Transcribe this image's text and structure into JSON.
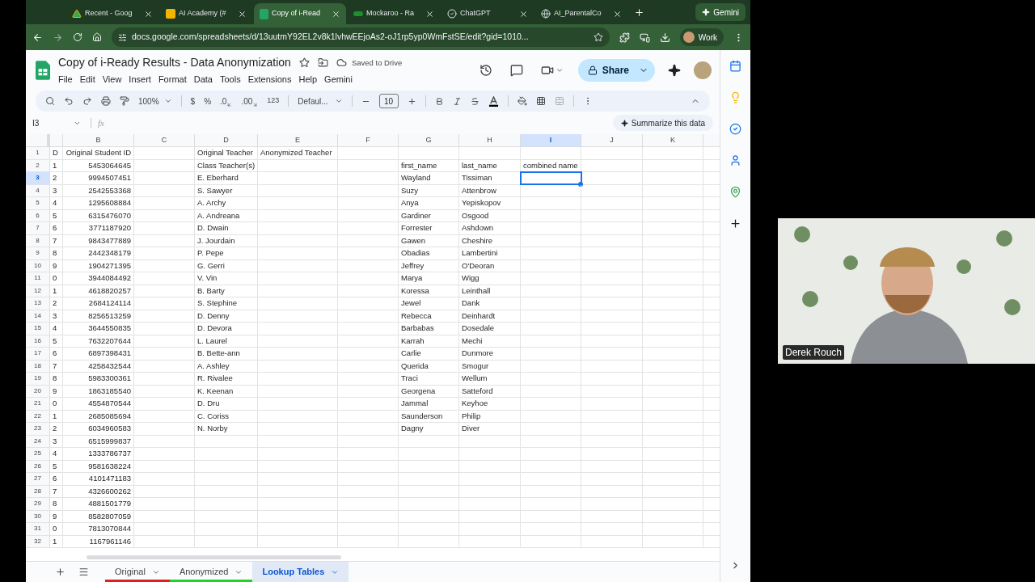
{
  "browser_tabs": [
    {
      "title": "Recent - Goog",
      "selected": false
    },
    {
      "title": "AI Academy (#",
      "selected": false
    },
    {
      "title": "Copy of i-Read",
      "selected": true
    },
    {
      "title": "Mockaroo - Ra",
      "selected": false
    },
    {
      "title": "ChatGPT",
      "selected": false
    },
    {
      "title": "AI_ParentalCo",
      "selected": false
    }
  ],
  "gemini_button": "Gemini",
  "address": "docs.google.com/spreadsheets/d/13uutmY92EL2v8k1lvhwEEjoAs2-oJ1rp5yp0WmFstSE/edit?gid=1010...",
  "profile": "Work",
  "doc": {
    "title": "Copy of i-Ready Results - Data Anonymization",
    "save_status": "Saved to Drive",
    "share": "Share"
  },
  "menu": [
    "File",
    "Edit",
    "View",
    "Insert",
    "Format",
    "Data",
    "Tools",
    "Extensions",
    "Help",
    "Gemini"
  ],
  "toolbar": {
    "zoom": "100%",
    "currency": "$",
    "percent": "%",
    "decrease_decimals": ".0",
    "increase_decimals": ".00",
    "number_format": "123",
    "font": "Defaul...",
    "font_size": "10"
  },
  "name_box": "I3",
  "formula_label": "fx",
  "summarize": "Summarize this data",
  "columns": [
    {
      "selected": false
    },
    {
      "label": "B",
      "selected": false
    },
    {
      "label": "C",
      "selected": false
    },
    {
      "label": "D",
      "selected": false
    },
    {
      "label": "E",
      "selected": false
    },
    {
      "label": "F",
      "selected": false
    },
    {
      "label": "G",
      "selected": false
    },
    {
      "label": "H",
      "selected": false
    },
    {
      "label": "I",
      "selected": true
    },
    {
      "label": "J",
      "selected": false
    },
    {
      "label": "K",
      "selected": false
    }
  ],
  "rows": [
    {
      "number": "1",
      "selected": false,
      "a": "D",
      "b": "Original Student ID",
      "d": "Original Teacher",
      "e": "Anonymized Teacher"
    },
    {
      "number": "2",
      "selected": false,
      "a": "1",
      "b": "5453064645",
      "d": "Class Teacher(s)",
      "g": "first_name",
      "h": "last_name",
      "i": "combined name"
    },
    {
      "number": "3",
      "selected": true,
      "a": "2",
      "b": "9994507451",
      "d": "E. Eberhard",
      "g": "Wayland",
      "h": "Tissiman"
    },
    {
      "number": "4",
      "selected": false,
      "a": "3",
      "b": "2542553368",
      "d": "S. Sawyer",
      "g": "Suzy",
      "h": "Attenbrow"
    },
    {
      "number": "5",
      "selected": false,
      "a": "4",
      "b": "1295608884",
      "d": "A. Archy",
      "g": "Anya",
      "h": "Yepiskopov"
    },
    {
      "number": "6",
      "selected": false,
      "a": "5",
      "b": "6315476070",
      "d": "A. Andreana",
      "g": "Gardiner",
      "h": "Osgood"
    },
    {
      "number": "7",
      "selected": false,
      "a": "6",
      "b": "3771187920",
      "d": "D. Dwain",
      "g": "Forrester",
      "h": "Ashdown"
    },
    {
      "number": "8",
      "selected": false,
      "a": "7",
      "b": "9843477889",
      "d": "J. Jourdain",
      "g": "Gawen",
      "h": "Cheshire"
    },
    {
      "number": "9",
      "selected": false,
      "a": "8",
      "b": "2442348179",
      "d": "P. Pepe",
      "g": "Obadias",
      "h": "Lambertini"
    },
    {
      "number": "10",
      "selected": false,
      "a": "9",
      "b": "1904271395",
      "d": "G. Gerri",
      "g": "Jeffrey",
      "h": "O'Deoran"
    },
    {
      "number": "11",
      "selected": false,
      "a": "0",
      "b": "3944084492",
      "d": "V. Vin",
      "g": "Marya",
      "h": "Wigg"
    },
    {
      "number": "12",
      "selected": false,
      "a": "1",
      "b": "4618820257",
      "d": "B. Barty",
      "g": "Koressa",
      "h": "Leinthall"
    },
    {
      "number": "13",
      "selected": false,
      "a": "2",
      "b": "2684124114",
      "d": "S. Stephine",
      "g": "Jewel",
      "h": "Dank"
    },
    {
      "number": "14",
      "selected": false,
      "a": "3",
      "b": "8256513259",
      "d": "D. Denny",
      "g": "Rebecca",
      "h": "Deinhardt"
    },
    {
      "number": "15",
      "selected": false,
      "a": "4",
      "b": "3644550835",
      "d": "D. Devora",
      "g": "Barbabas",
      "h": "Dosedale"
    },
    {
      "number": "16",
      "selected": false,
      "a": "5",
      "b": "7632207644",
      "d": "L. Laurel",
      "g": "Karrah",
      "h": "Mechi"
    },
    {
      "number": "17",
      "selected": false,
      "a": "6",
      "b": "6897398431",
      "d": "B. Bette-ann",
      "g": "Carlie",
      "h": "Dunmore"
    },
    {
      "number": "18",
      "selected": false,
      "a": "7",
      "b": "4258432544",
      "d": "A. Ashley",
      "g": "Querida",
      "h": "Smogur"
    },
    {
      "number": "19",
      "selected": false,
      "a": "8",
      "b": "5983300361",
      "d": "R. Rivalee",
      "g": "Traci",
      "h": "Wellum"
    },
    {
      "number": "20",
      "selected": false,
      "a": "9",
      "b": "1863185540",
      "d": "K. Keenan",
      "g": "Georgena",
      "h": "Satteford"
    },
    {
      "number": "21",
      "selected": false,
      "a": "0",
      "b": "4554870544",
      "d": "D. Dru",
      "g": "Jammal",
      "h": "Keyhoe"
    },
    {
      "number": "22",
      "selected": false,
      "a": "1",
      "b": "2685085694",
      "d": "C. Coriss",
      "g": "Saunderson",
      "h": "Philip"
    },
    {
      "number": "23",
      "selected": false,
      "a": "2",
      "b": "6034960583",
      "d": "N. Norby",
      "g": "Dagny",
      "h": "Diver"
    },
    {
      "number": "24",
      "selected": false,
      "a": "3",
      "b": "6515999837"
    },
    {
      "number": "25",
      "selected": false,
      "a": "4",
      "b": "1333786737"
    },
    {
      "number": "26",
      "selected": false,
      "a": "5",
      "b": "9581638224"
    },
    {
      "number": "27",
      "selected": false,
      "a": "6",
      "b": "4101471183"
    },
    {
      "number": "28",
      "selected": false,
      "a": "7",
      "b": "4326600262"
    },
    {
      "number": "29",
      "selected": false,
      "a": "8",
      "b": "4881501779"
    },
    {
      "number": "30",
      "selected": false,
      "a": "9",
      "b": "8582807059"
    },
    {
      "number": "31",
      "selected": false,
      "a": "0",
      "b": "7813070844"
    },
    {
      "number": "32",
      "selected": false,
      "a": "1",
      "b": "1167961146"
    }
  ],
  "sheet_tabs": [
    {
      "name": "Original",
      "color": "#e02020",
      "selected": false
    },
    {
      "name": "Anonymized",
      "color": "#22d322",
      "selected": false
    },
    {
      "name": "Lookup Tables",
      "selected": true
    }
  ],
  "video": {
    "kind": "picture",
    "name": "Derek Rouch"
  }
}
